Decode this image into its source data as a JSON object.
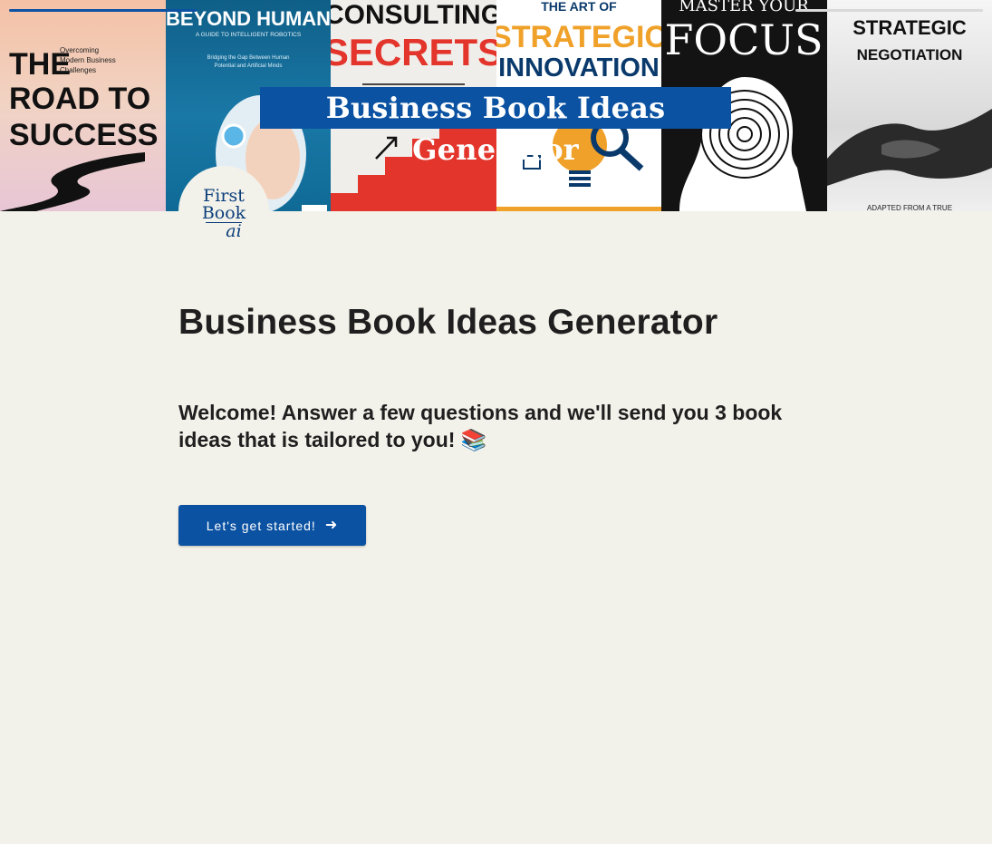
{
  "hero": {
    "banner_title": "Business Book Ideas Generator",
    "covers": [
      {
        "name": "the-road-to-success",
        "title": "THE ROAD TO SUCCESS",
        "subtitle": "Overcoming Modern Business Challenges",
        "colors": {
          "text": "#111111"
        }
      },
      {
        "name": "beyond-human",
        "title": "BEYOND HUMAN",
        "subtitle": "A GUIDE TO INTELLIGENT ROBOTICS",
        "tagline": "Bridging the Gap Between Human Potential and Artificial Minds",
        "colors": {
          "text": "#ffffff"
        }
      },
      {
        "name": "consulting-secrets",
        "title": "CONSULTING SECRETS",
        "colors": {
          "title": "#e3352b",
          "text": "#111111"
        }
      },
      {
        "name": "the-art-of-strategic-innovation",
        "title_line_1": "THE ART OF",
        "title_line_2": "STRATEGIC",
        "title_line_3": "INNOVATION",
        "colors": {
          "accent": "#f0a12a",
          "text": "#0a3a6c"
        }
      },
      {
        "name": "master-your-focus",
        "title_line_1": "MASTER YOUR",
        "title_line_2": "FOCUS",
        "colors": {
          "text": "#ffffff"
        }
      },
      {
        "name": "strategic-negotiation",
        "title_line_1": "STRATEGIC",
        "title_line_2": "NEGOTIATION",
        "footer": "ADAPTED FROM A TRUE",
        "colors": {
          "text": "#111111"
        }
      }
    ]
  },
  "logo": {
    "line_1": "First",
    "line_2": "Book",
    "line_3": "ai"
  },
  "main": {
    "title": "Business Book Ideas Generator",
    "welcome_text": "Welcome! Answer a few questions and we'll send you 3 book ideas that is tailored to you!",
    "welcome_emoji": "📚",
    "cta_label": "Let's get started!"
  },
  "theme": {
    "primary": "#0b52a2",
    "background": "#f3f2ea",
    "text": "#1f1f1f"
  }
}
